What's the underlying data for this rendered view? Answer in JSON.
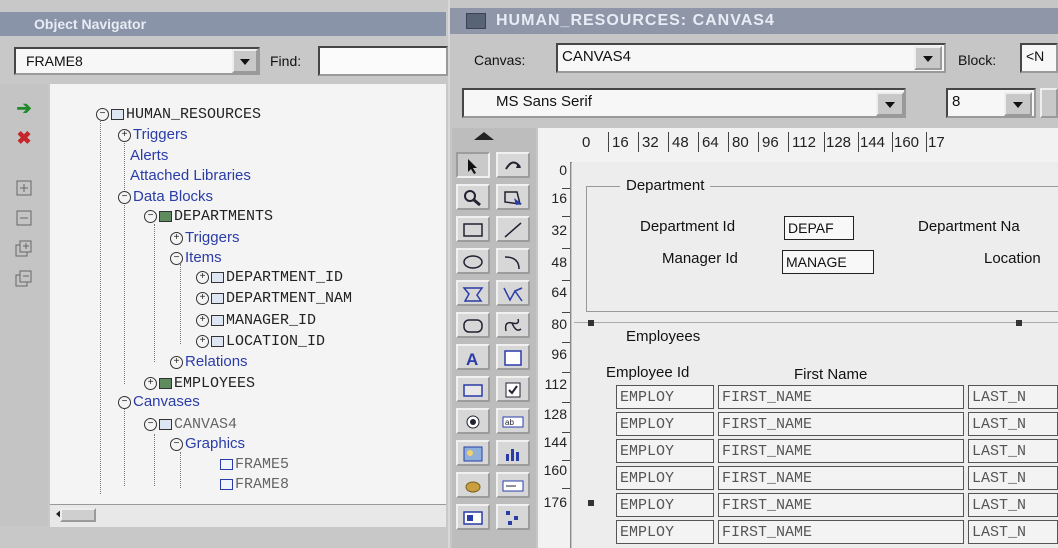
{
  "navigator": {
    "title": "Object Navigator",
    "frame_selector": "FRAME8",
    "find_label": "Find:",
    "find_value": "",
    "tree": [
      {
        "label": "HUMAN_RESOURCES"
      },
      {
        "label": "Triggers"
      },
      {
        "label": "Alerts"
      },
      {
        "label": "Attached Libraries"
      },
      {
        "label": "Data Blocks"
      },
      {
        "label": "DEPARTMENTS"
      },
      {
        "label": "Triggers"
      },
      {
        "label": "Items"
      },
      {
        "label": "DEPARTMENT_ID"
      },
      {
        "label": "DEPARTMENT_NAM"
      },
      {
        "label": "MANAGER_ID"
      },
      {
        "label": "LOCATION_ID"
      },
      {
        "label": "Relations"
      },
      {
        "label": "EMPLOYEES"
      },
      {
        "label": "Canvases"
      },
      {
        "label": "CANVAS4"
      },
      {
        "label": "Graphics"
      },
      {
        "label": "FRAME5"
      },
      {
        "label": "FRAME8"
      }
    ]
  },
  "canvas_window": {
    "title": "HUMAN_RESOURCES: CANVAS4",
    "canvas_label": "Canvas:",
    "canvas_value": "CANVAS4",
    "block_label": "Block:",
    "block_value": "<N",
    "font_name": "MS Sans Serif",
    "font_size": "8"
  },
  "rulers": {
    "horizontal": [
      "0",
      "16",
      "32",
      "48",
      "64",
      "80",
      "96",
      "112",
      "128",
      "144",
      "160",
      "17"
    ],
    "vertical": [
      "0",
      "16",
      "32",
      "48",
      "64",
      "80",
      "96",
      "112",
      "128",
      "144",
      "160",
      "176"
    ]
  },
  "department": {
    "frame_title": "Department",
    "dept_id_label": "Department Id",
    "dept_id_value": "DEPAF",
    "dept_name_label": "Department Na",
    "manager_label": "Manager Id",
    "manager_value": "MANAGE",
    "location_label": "Location"
  },
  "employees": {
    "frame_title": "Employees",
    "col_employee_id": "Employee Id",
    "col_first_name": "First Name",
    "rows": [
      {
        "id": "EMPLOY",
        "first": "FIRST_NAME",
        "last": "LAST_N"
      },
      {
        "id": "EMPLOY",
        "first": "FIRST_NAME",
        "last": "LAST_N"
      },
      {
        "id": "EMPLOY",
        "first": "FIRST_NAME",
        "last": "LAST_N"
      },
      {
        "id": "EMPLOY",
        "first": "FIRST_NAME",
        "last": "LAST_N"
      },
      {
        "id": "EMPLOY",
        "first": "FIRST_NAME",
        "last": "LAST_N"
      },
      {
        "id": "EMPLOY",
        "first": "FIRST_NAME",
        "last": "LAST_N"
      }
    ]
  },
  "palette_tools": [
    "select-icon",
    "rotate-icon",
    "magnify-icon",
    "reshape-icon",
    "rectangle-icon",
    "line-icon",
    "ellipse-icon",
    "arc-icon",
    "polygon-icon",
    "polyline-icon",
    "rounded-rectangle-icon",
    "freehand-icon",
    "text-icon",
    "frame-icon",
    "button-icon",
    "checkbox-icon",
    "radio-button-icon",
    "text-item-icon",
    "image-icon",
    "chart-icon",
    "sound-icon",
    "list-item-icon",
    "display-item-icon",
    "tab-canvas-icon"
  ]
}
